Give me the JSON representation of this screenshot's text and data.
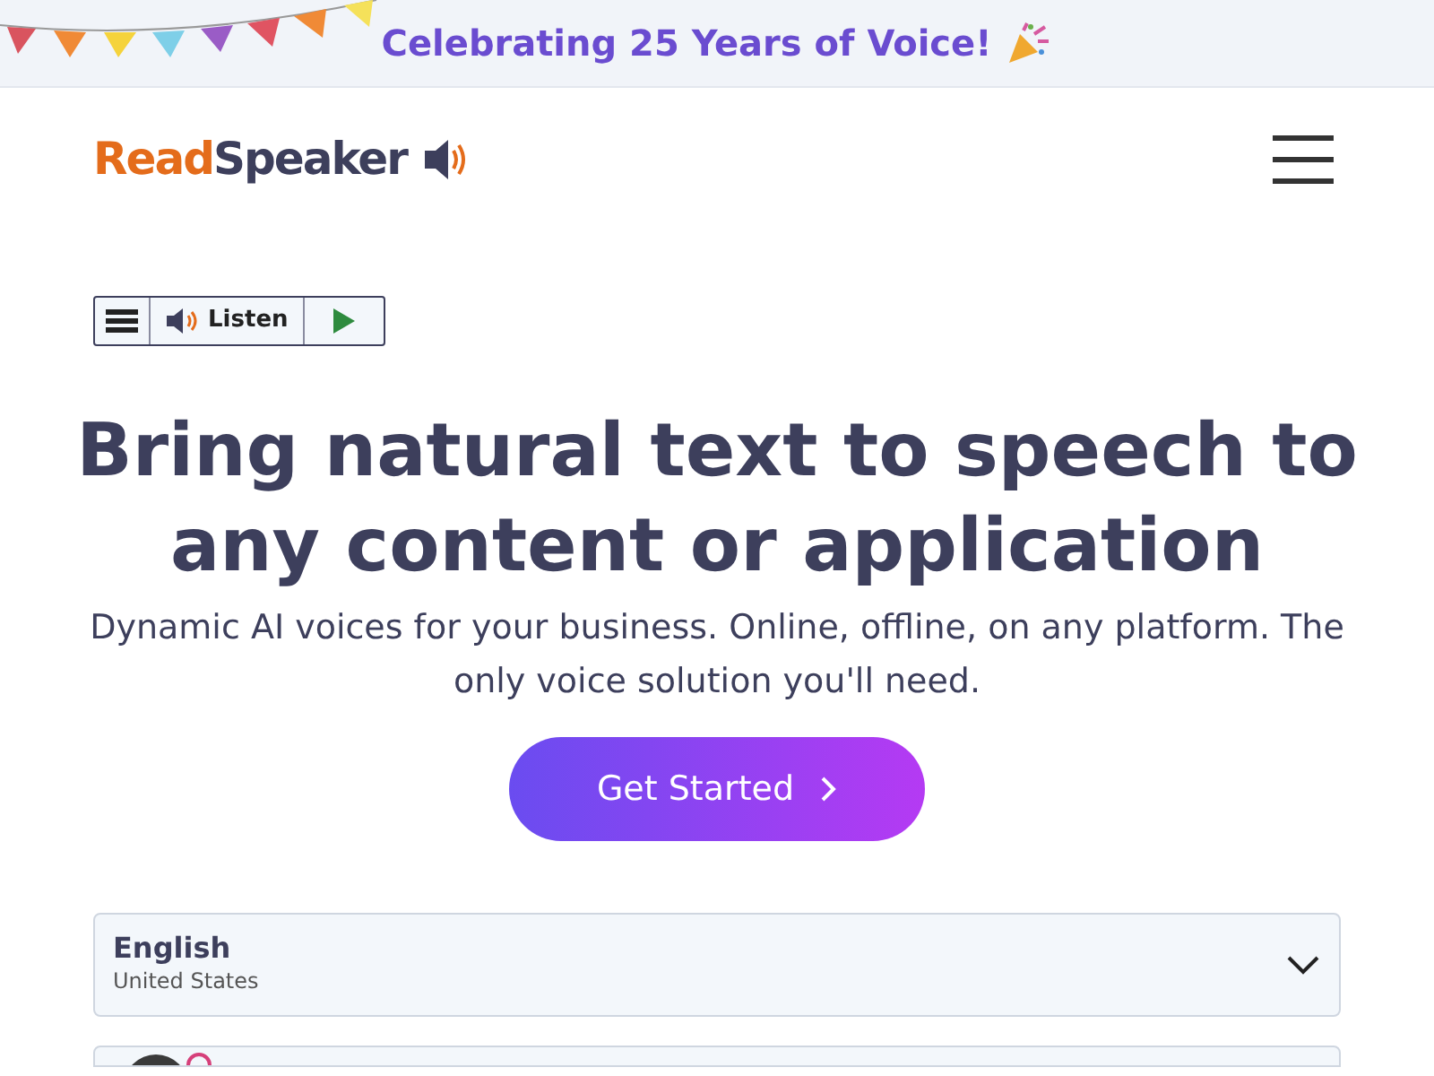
{
  "banner": {
    "text": "Celebrating 25 Years of Voice!"
  },
  "header": {
    "logo": {
      "first": "Read",
      "second": "Speaker"
    }
  },
  "listen_widget": {
    "label": "Listen"
  },
  "hero": {
    "title": "Bring natural text to speech to any content or application",
    "subtitle": "Dynamic AI voices for your business. Online, offline, on any platform. The only voice solution you'll need.",
    "button": "Get Started"
  },
  "language_select": {
    "language": "English",
    "region": "United States",
    "expanded": false
  }
}
